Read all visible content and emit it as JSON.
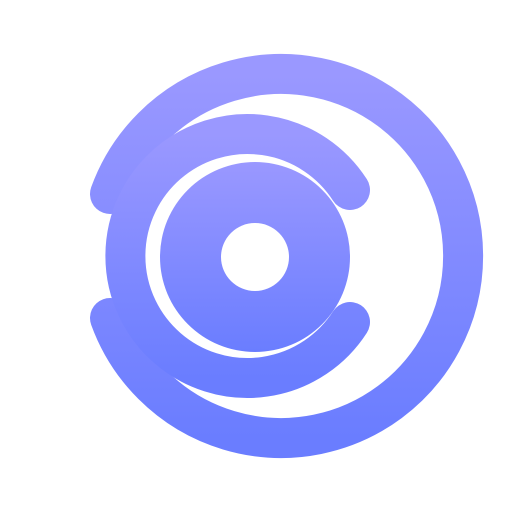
{
  "logo": {
    "icon_name": "stylized-c-eye-logo",
    "colors": {
      "gradient_top": "#9A98FF",
      "gradient_bottom": "#6A7DFF",
      "background": "#FFFFFF"
    }
  }
}
